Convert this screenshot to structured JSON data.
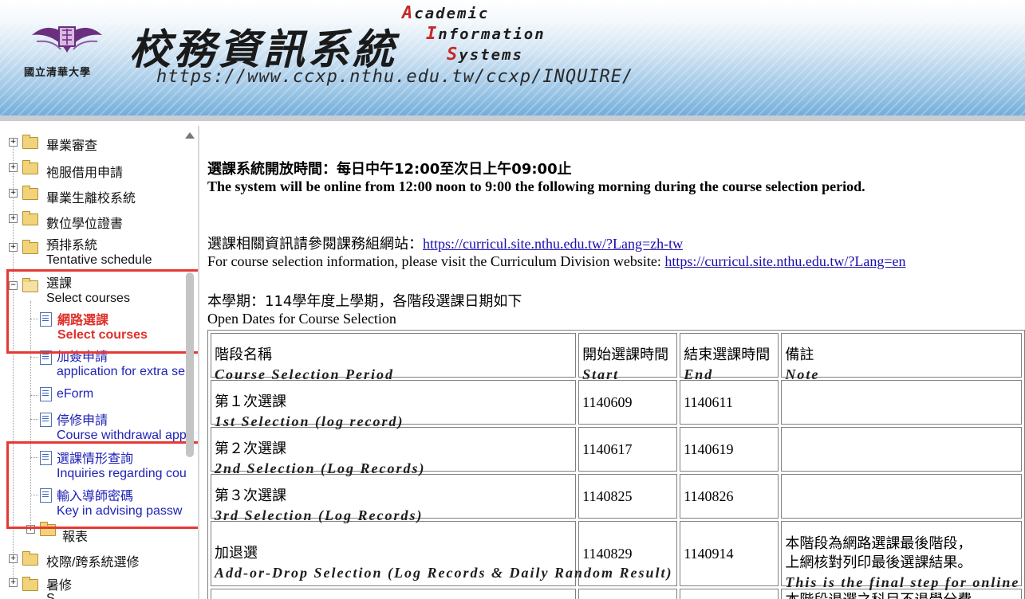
{
  "header": {
    "title_zh": "校務資訊系統",
    "university": "國立清華大學",
    "url": "https://www.ccxp.nthu.edu.tw/ccxp/INQUIRE/",
    "en_line1_cap": "A",
    "en_line1_rest": "cademic",
    "en_line2_cap": "I",
    "en_line2_rest": "nformation",
    "en_line3_cap": "S",
    "en_line3_rest": "ystems"
  },
  "sidebar": {
    "items": [
      {
        "label": "畢業審查"
      },
      {
        "label": "袍服借用申請"
      },
      {
        "label": "畢業生離校系統"
      },
      {
        "label": "數位學位證書"
      },
      {
        "label": "預排系統",
        "sub": "Tentative schedule"
      },
      {
        "label": "選課",
        "sub": "Select courses"
      }
    ],
    "children": [
      {
        "label": "網路選課",
        "sub": "Select courses"
      },
      {
        "label": "加簽申請",
        "sub": "application for extra se"
      },
      {
        "label": "eForm"
      },
      {
        "label": "停修申請",
        "sub": "Course withdrawal app"
      },
      {
        "label": "選課情形查詢",
        "sub": "Inquiries regarding cou"
      },
      {
        "label": "輸入導師密碼",
        "sub": "Key in advising passw"
      },
      {
        "label": "報表"
      }
    ],
    "bottom_items": [
      {
        "label": "校際/跨系統選修"
      },
      {
        "label": "暑修"
      },
      {
        "label": "S"
      }
    ]
  },
  "main": {
    "open_time_zh": "選課系統開放時間：每日中午12:00至次日上午09:00止",
    "open_time_en": "The system will be online from 12:00 noon to 9:00 the following morning during the course selection period.",
    "info_zh_prefix": "選課相關資訊請參閱課務組網站：",
    "info_link": "https://curricul.site.nthu.edu.tw/?Lang=zh-tw",
    "info_en_prefix": "For course selection information, please visit the Curriculum Division website: ",
    "info_link_en": "https://curricul.site.nthu.edu.tw/?Lang=en",
    "semester_zh": "本學期：114學年度上學期，各階段選課日期如下",
    "semester_en": "Open Dates for Course Selection",
    "table": {
      "headers": [
        {
          "zh": "階段名稱",
          "en": "Course Selection Period"
        },
        {
          "zh": "開始選課時間",
          "en": "Start"
        },
        {
          "zh": "結束選課時間",
          "en": "End"
        },
        {
          "zh": "備註",
          "en": "Note"
        }
      ],
      "rows": [
        {
          "zh": "第１次選課",
          "en": "1st Selection (log record)",
          "start": "1140609",
          "end": "1140611",
          "note_zh1": "",
          "note_zh2": "",
          "note_en": ""
        },
        {
          "zh": "第２次選課",
          "en": "2nd Selection (Log Records)",
          "start": "1140617",
          "end": "1140619",
          "note_zh1": "",
          "note_zh2": "",
          "note_en": ""
        },
        {
          "zh": "第３次選課",
          "en": "3rd Selection (Log Records)",
          "start": "1140825",
          "end": "1140826",
          "note_zh1": "",
          "note_zh2": "",
          "note_en": ""
        },
        {
          "zh": "加退選",
          "en": "Add-or-Drop Selection (Log Records & Daily Random Result)",
          "start": "1140829",
          "end": "1140914",
          "note_zh1": "本階段為網路選課最後階段，",
          "note_zh2": "上網核對列印最後選課結果。",
          "note_en": "This is the final step for online c"
        }
      ],
      "partial_note": "本階段退選之科目不退學分費"
    }
  }
}
